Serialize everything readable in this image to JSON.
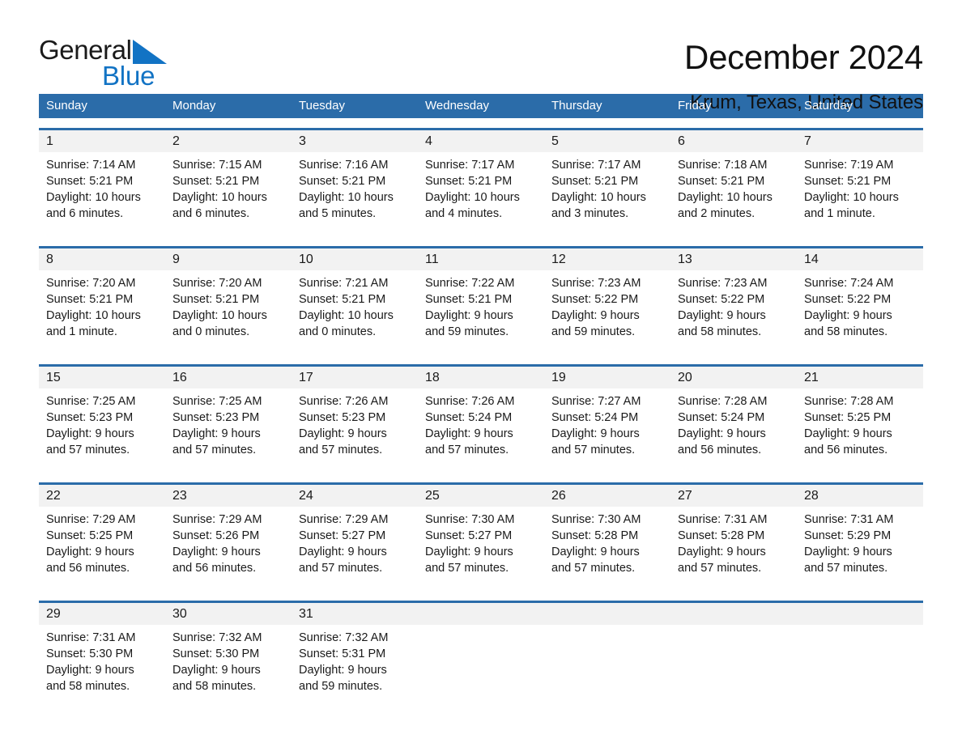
{
  "logo": {
    "word1": "General",
    "word2": "Blue",
    "triangle_icon": "blue-triangle-icon",
    "blue_hex": "#1273c4"
  },
  "header": {
    "title": "December 2024",
    "subtitle": "Krum, Texas, United States"
  },
  "theme": {
    "header_blue": "#2B6CA9",
    "daynum_band": "#f2f2f2",
    "text": "#1a1a1a"
  },
  "weekdays": [
    "Sunday",
    "Monday",
    "Tuesday",
    "Wednesday",
    "Thursday",
    "Friday",
    "Saturday"
  ],
  "weeks": [
    {
      "daynums": [
        "1",
        "2",
        "3",
        "4",
        "5",
        "6",
        "7"
      ],
      "cells": [
        "Sunrise: 7:14 AM\nSunset: 5:21 PM\nDaylight: 10 hours\nand 6 minutes.",
        "Sunrise: 7:15 AM\nSunset: 5:21 PM\nDaylight: 10 hours\nand 6 minutes.",
        "Sunrise: 7:16 AM\nSunset: 5:21 PM\nDaylight: 10 hours\nand 5 minutes.",
        "Sunrise: 7:17 AM\nSunset: 5:21 PM\nDaylight: 10 hours\nand 4 minutes.",
        "Sunrise: 7:17 AM\nSunset: 5:21 PM\nDaylight: 10 hours\nand 3 minutes.",
        "Sunrise: 7:18 AM\nSunset: 5:21 PM\nDaylight: 10 hours\nand 2 minutes.",
        "Sunrise: 7:19 AM\nSunset: 5:21 PM\nDaylight: 10 hours\nand 1 minute."
      ]
    },
    {
      "daynums": [
        "8",
        "9",
        "10",
        "11",
        "12",
        "13",
        "14"
      ],
      "cells": [
        "Sunrise: 7:20 AM\nSunset: 5:21 PM\nDaylight: 10 hours\nand 1 minute.",
        "Sunrise: 7:20 AM\nSunset: 5:21 PM\nDaylight: 10 hours\nand 0 minutes.",
        "Sunrise: 7:21 AM\nSunset: 5:21 PM\nDaylight: 10 hours\nand 0 minutes.",
        "Sunrise: 7:22 AM\nSunset: 5:21 PM\nDaylight: 9 hours\nand 59 minutes.",
        "Sunrise: 7:23 AM\nSunset: 5:22 PM\nDaylight: 9 hours\nand 59 minutes.",
        "Sunrise: 7:23 AM\nSunset: 5:22 PM\nDaylight: 9 hours\nand 58 minutes.",
        "Sunrise: 7:24 AM\nSunset: 5:22 PM\nDaylight: 9 hours\nand 58 minutes."
      ]
    },
    {
      "daynums": [
        "15",
        "16",
        "17",
        "18",
        "19",
        "20",
        "21"
      ],
      "cells": [
        "Sunrise: 7:25 AM\nSunset: 5:23 PM\nDaylight: 9 hours\nand 57 minutes.",
        "Sunrise: 7:25 AM\nSunset: 5:23 PM\nDaylight: 9 hours\nand 57 minutes.",
        "Sunrise: 7:26 AM\nSunset: 5:23 PM\nDaylight: 9 hours\nand 57 minutes.",
        "Sunrise: 7:26 AM\nSunset: 5:24 PM\nDaylight: 9 hours\nand 57 minutes.",
        "Sunrise: 7:27 AM\nSunset: 5:24 PM\nDaylight: 9 hours\nand 57 minutes.",
        "Sunrise: 7:28 AM\nSunset: 5:24 PM\nDaylight: 9 hours\nand 56 minutes.",
        "Sunrise: 7:28 AM\nSunset: 5:25 PM\nDaylight: 9 hours\nand 56 minutes."
      ]
    },
    {
      "daynums": [
        "22",
        "23",
        "24",
        "25",
        "26",
        "27",
        "28"
      ],
      "cells": [
        "Sunrise: 7:29 AM\nSunset: 5:25 PM\nDaylight: 9 hours\nand 56 minutes.",
        "Sunrise: 7:29 AM\nSunset: 5:26 PM\nDaylight: 9 hours\nand 56 minutes.",
        "Sunrise: 7:29 AM\nSunset: 5:27 PM\nDaylight: 9 hours\nand 57 minutes.",
        "Sunrise: 7:30 AM\nSunset: 5:27 PM\nDaylight: 9 hours\nand 57 minutes.",
        "Sunrise: 7:30 AM\nSunset: 5:28 PM\nDaylight: 9 hours\nand 57 minutes.",
        "Sunrise: 7:31 AM\nSunset: 5:28 PM\nDaylight: 9 hours\nand 57 minutes.",
        "Sunrise: 7:31 AM\nSunset: 5:29 PM\nDaylight: 9 hours\nand 57 minutes."
      ]
    },
    {
      "daynums": [
        "29",
        "30",
        "31",
        "",
        "",
        "",
        ""
      ],
      "cells": [
        "Sunrise: 7:31 AM\nSunset: 5:30 PM\nDaylight: 9 hours\nand 58 minutes.",
        "Sunrise: 7:32 AM\nSunset: 5:30 PM\nDaylight: 9 hours\nand 58 minutes.",
        "Sunrise: 7:32 AM\nSunset: 5:31 PM\nDaylight: 9 hours\nand 59 minutes.",
        "",
        "",
        "",
        ""
      ]
    }
  ]
}
